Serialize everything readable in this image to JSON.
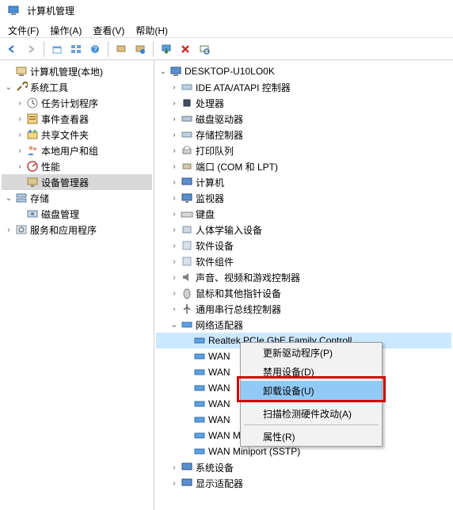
{
  "title": "计算机管理",
  "menu": {
    "file": "文件(F)",
    "action": "操作(A)",
    "view": "查看(V)",
    "help": "帮助(H)"
  },
  "left_tree": {
    "root": "计算机管理(本地)",
    "system_tools": "系统工具",
    "task_scheduler": "任务计划程序",
    "event_viewer": "事件查看器",
    "shared_folders": "共享文件夹",
    "local_users": "本地用户和组",
    "performance": "性能",
    "device_manager": "设备管理器",
    "storage": "存储",
    "disk_management": "磁盘管理",
    "services": "服务和应用程序"
  },
  "right_tree": {
    "root": "DESKTOP-U10LO0K",
    "ide": "IDE ATA/ATAPI 控制器",
    "processor": "处理器",
    "disk_drive": "磁盘驱动器",
    "storage_ctrl": "存储控制器",
    "print_queue": "打印队列",
    "ports": "端口 (COM 和 LPT)",
    "computer": "计算机",
    "monitor": "监视器",
    "keyboard": "键盘",
    "hid": "人体学输入设备",
    "software_dev": "软件设备",
    "software_comp": "软件组件",
    "audio": "声音、视频和游戏控制器",
    "mouse": "鼠标和其他指针设备",
    "usb": "通用串行总线控制器",
    "network": "网络适配器",
    "realtek": "Realtek PCIe GbE Family Controll",
    "wan1": "WAN",
    "wan2": "WAN",
    "wan3": "WAN",
    "wan4": "WAN",
    "wan5": "WAN",
    "wan_pptp": "WAN Miniport (PPTP)",
    "wan_sstp": "WAN Miniport (SSTP)",
    "system_dev": "系统设备",
    "display": "显示适配器"
  },
  "context": {
    "update": "更新驱动程序(P)",
    "disable": "禁用设备(D)",
    "uninstall": "卸载设备(U)",
    "scan": "扫描检测硬件改动(A)",
    "props": "属性(R)"
  }
}
